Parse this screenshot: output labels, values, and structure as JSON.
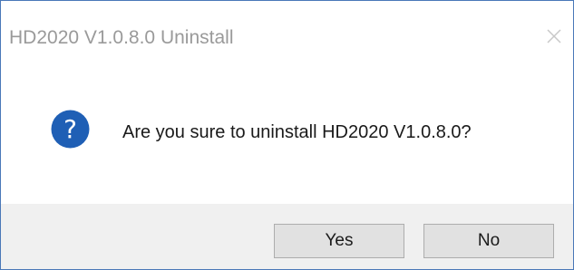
{
  "window": {
    "title": "HD2020 V1.0.8.0 Uninstall",
    "close_icon": "close-icon"
  },
  "dialog": {
    "icon": "question-icon",
    "message": "Are you sure to uninstall HD2020 V1.0.8.0?"
  },
  "buttons": {
    "yes_label": "Yes",
    "no_label": "No"
  },
  "colors": {
    "border": "#4a78b8",
    "title_text": "#9a9a9a",
    "icon_blue": "#1f5fb5",
    "footer_bg": "#f0f0f0",
    "button_bg": "#e1e1e1",
    "button_border": "#adadad"
  }
}
